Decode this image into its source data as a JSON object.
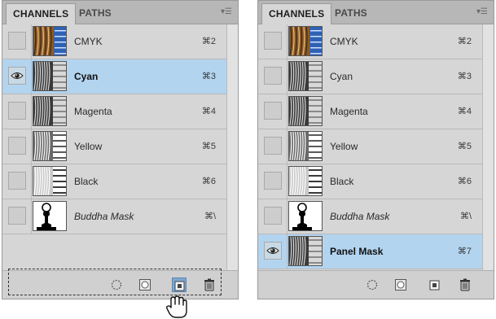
{
  "panels": [
    {
      "tabs": [
        {
          "label": "CHANNELS",
          "active": true
        },
        {
          "label": "PATHS",
          "active": false
        }
      ],
      "channels": [
        {
          "name": "CMYK",
          "shortcut": "⌘2",
          "visible": false,
          "selected": false,
          "thumb": "cmyk",
          "italic": false
        },
        {
          "name": "Cyan",
          "shortcut": "⌘3",
          "visible": true,
          "selected": true,
          "thumb": "gray",
          "italic": false
        },
        {
          "name": "Magenta",
          "shortcut": "⌘4",
          "visible": false,
          "selected": false,
          "thumb": "gray",
          "italic": false
        },
        {
          "name": "Yellow",
          "shortcut": "⌘5",
          "visible": false,
          "selected": false,
          "thumb": "light",
          "italic": false
        },
        {
          "name": "Black",
          "shortcut": "⌘6",
          "visible": false,
          "selected": false,
          "thumb": "lighter",
          "italic": false
        },
        {
          "name": "Buddha Mask",
          "shortcut": "⌘\\",
          "visible": false,
          "selected": false,
          "thumb": "buddha",
          "italic": true
        }
      ],
      "new_channel_pressed": true
    },
    {
      "tabs": [
        {
          "label": "CHANNELS",
          "active": true
        },
        {
          "label": "PATHS",
          "active": false
        }
      ],
      "channels": [
        {
          "name": "CMYK",
          "shortcut": "⌘2",
          "visible": false,
          "selected": false,
          "thumb": "cmyk",
          "italic": false
        },
        {
          "name": "Cyan",
          "shortcut": "⌘3",
          "visible": false,
          "selected": false,
          "thumb": "gray",
          "italic": false
        },
        {
          "name": "Magenta",
          "shortcut": "⌘4",
          "visible": false,
          "selected": false,
          "thumb": "gray",
          "italic": false
        },
        {
          "name": "Yellow",
          "shortcut": "⌘5",
          "visible": false,
          "selected": false,
          "thumb": "light",
          "italic": false
        },
        {
          "name": "Black",
          "shortcut": "⌘6",
          "visible": false,
          "selected": false,
          "thumb": "lighter",
          "italic": false
        },
        {
          "name": "Buddha Mask",
          "shortcut": "⌘\\",
          "visible": false,
          "selected": false,
          "thumb": "buddha",
          "italic": true
        },
        {
          "name": "Panel Mask",
          "shortcut": "⌘7",
          "visible": true,
          "selected": true,
          "thumb": "gray",
          "italic": false
        }
      ],
      "new_channel_pressed": false
    }
  ],
  "footer_icons": [
    "load-selection-icon",
    "save-selection-icon",
    "new-channel-icon",
    "trash-icon"
  ],
  "colors": {
    "panel_bg": "#d6d6d6",
    "tab_bar": "#b7b7b7",
    "selected_row": "#b3d4ef",
    "pressed_button": "#7fa7cf"
  }
}
